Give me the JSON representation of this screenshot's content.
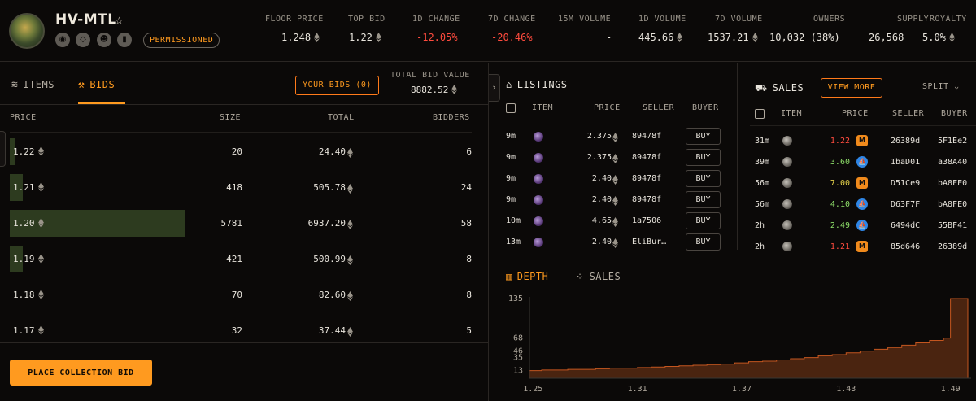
{
  "collection": {
    "name": "HV-MTL",
    "badge": "PERMISSIONED",
    "social_icons": [
      "website-icon",
      "opensea-icon",
      "discord-icon",
      "stats-icon"
    ]
  },
  "stats": [
    {
      "label": "FLOOR PRICE",
      "value": "1.248",
      "eth": true,
      "color": "default"
    },
    {
      "label": "TOP BID",
      "value": "1.22",
      "eth": true,
      "color": "default"
    },
    {
      "label": "1D CHANGE",
      "value": "-12.05%",
      "eth": false,
      "color": "red"
    },
    {
      "label": "7D CHANGE",
      "value": "-20.46%",
      "eth": false,
      "color": "red"
    },
    {
      "label": "15M VOLUME",
      "value": "-",
      "eth": false,
      "color": "default"
    },
    {
      "label": "1D VOLUME",
      "value": "445.66",
      "eth": true,
      "color": "default"
    },
    {
      "label": "7D VOLUME",
      "value": "1537.21",
      "eth": true,
      "color": "default"
    },
    {
      "label": "OWNERS",
      "value": "10,032 (38%)",
      "eth": false,
      "color": "default"
    },
    {
      "label": "SUPPLY",
      "value": "26,568",
      "eth": false,
      "color": "default"
    },
    {
      "label": "ROYALTY",
      "value": "5.0%",
      "eth": true,
      "color": "default"
    }
  ],
  "left_panel": {
    "tabs": {
      "items": "ITEMS",
      "bids": "BIDS"
    },
    "your_bids_label": "YOUR BIDS (0)",
    "total_bid_value_label": "TOTAL BID VALUE",
    "total_bid_value": "8882.52",
    "columns": {
      "price": "PRICE",
      "size": "SIZE",
      "total": "TOTAL",
      "bidders": "BIDDERS"
    },
    "bids": [
      {
        "price": "1.22",
        "size": "20",
        "total": "24.40",
        "bidders": "6",
        "depth": 0.0035
      },
      {
        "price": "1.21",
        "size": "418",
        "total": "505.78",
        "bidders": "24",
        "depth": 0.073
      },
      {
        "price": "1.20",
        "size": "5781",
        "total": "6937.20",
        "bidders": "58",
        "depth": 1.0
      },
      {
        "price": "1.19",
        "size": "421",
        "total": "500.99",
        "bidders": "8",
        "depth": 0.073
      },
      {
        "price": "1.18",
        "size": "70",
        "total": "82.60",
        "bidders": "8",
        "depth": 0.0
      },
      {
        "price": "1.17",
        "size": "32",
        "total": "37.44",
        "bidders": "5",
        "depth": 0.0
      }
    ],
    "place_bid_label": "PLACE COLLECTION BID"
  },
  "listings": {
    "title": "LISTINGS",
    "columns": {
      "item": "ITEM",
      "price": "PRICE",
      "seller": "SELLER",
      "buyer": "BUYER"
    },
    "buy_label": "BUY",
    "rows": [
      {
        "time": "9m",
        "price": "2.375",
        "seller": "89478f"
      },
      {
        "time": "9m",
        "price": "2.375",
        "seller": "89478f"
      },
      {
        "time": "9m",
        "price": "2.40",
        "seller": "89478f"
      },
      {
        "time": "9m",
        "price": "2.40",
        "seller": "89478f"
      },
      {
        "time": "10m",
        "price": "4.65",
        "seller": "1a7506"
      },
      {
        "time": "13m",
        "price": "2.40",
        "seller": "EliBur…"
      }
    ]
  },
  "sales": {
    "title": "SALES",
    "view_more_label": "VIEW MORE",
    "split_label": "SPLIT",
    "columns": {
      "item": "ITEM",
      "price": "PRICE",
      "seller": "SELLER",
      "buyer": "BUYER"
    },
    "rows": [
      {
        "time": "31m",
        "price": "1.22",
        "price_color": "#ff4b3e",
        "market": "magic-eden-icon",
        "seller": "26389d",
        "buyer": "5F1Ee2"
      },
      {
        "time": "39m",
        "price": "3.60",
        "price_color": "#8fe06a",
        "market": "opensea-icon",
        "seller": "1baD01",
        "buyer": "a38A40"
      },
      {
        "time": "56m",
        "price": "7.00",
        "price_color": "#e6d34b",
        "market": "magic-eden-icon",
        "seller": "D51Ce9",
        "buyer": "bA8FE0"
      },
      {
        "time": "56m",
        "price": "4.10",
        "price_color": "#8fe06a",
        "market": "opensea-icon",
        "seller": "D63F7F",
        "buyer": "bA8FE0"
      },
      {
        "time": "2h",
        "price": "2.49",
        "price_color": "#8fe06a",
        "market": "opensea-icon",
        "seller": "6494dC",
        "buyer": "55BF41"
      },
      {
        "time": "2h",
        "price": "1.21",
        "price_color": "#ff4b3e",
        "market": "magic-eden-icon",
        "seller": "85d646",
        "buyer": "26389d"
      }
    ]
  },
  "chart_tabs": {
    "depth": "DEPTH",
    "sales": "SALES"
  },
  "chart_data": {
    "type": "area",
    "title": "",
    "xlabel": "",
    "ylabel": "",
    "x_ticks": [
      "1.25",
      "1.31",
      "1.37",
      "1.43",
      "1.49"
    ],
    "y_ticks": [
      "13",
      "35",
      "46",
      "68",
      "135"
    ],
    "xlim": [
      1.248,
      1.5
    ],
    "ylim": [
      0,
      135
    ],
    "step": true,
    "fill_color": "#4a2410",
    "line_color": "#c4561f",
    "x": [
      1.248,
      1.255,
      1.262,
      1.27,
      1.278,
      1.286,
      1.294,
      1.302,
      1.31,
      1.318,
      1.326,
      1.334,
      1.342,
      1.35,
      1.358,
      1.366,
      1.374,
      1.382,
      1.39,
      1.398,
      1.406,
      1.414,
      1.422,
      1.43,
      1.438,
      1.446,
      1.454,
      1.462,
      1.47,
      1.478,
      1.486,
      1.49,
      1.496
    ],
    "y": [
      13,
      14,
      14,
      15,
      15,
      16,
      17,
      17,
      18,
      19,
      20,
      21,
      22,
      23,
      24,
      26,
      28,
      29,
      31,
      33,
      35,
      38,
      40,
      43,
      46,
      49,
      52,
      56,
      60,
      64,
      68,
      135,
      135
    ]
  }
}
